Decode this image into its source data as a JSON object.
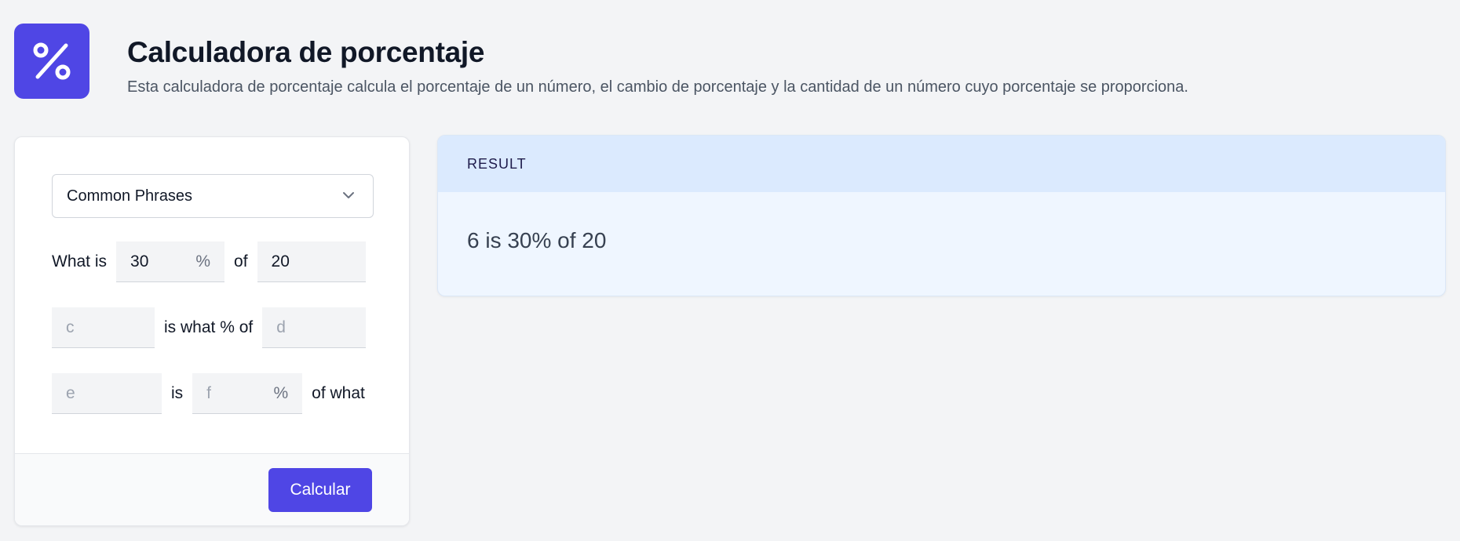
{
  "header": {
    "logo_icon": "percent-icon",
    "title": "Calculadora de porcentaje",
    "subtitle": "Esta calculadora de porcentaje calcula el porcentaje de un número, el cambio de porcentaje y la cantidad de un número cuyo porcentaje se proporciona."
  },
  "form": {
    "select_value": "Common Phrases",
    "row1": {
      "label_a": "What is",
      "input_a_value": "30",
      "pct": "%",
      "label_b": "of",
      "input_b_value": "20"
    },
    "row2": {
      "input_c_placeholder": "c",
      "label": "is what % of",
      "input_d_placeholder": "d"
    },
    "row3": {
      "input_e_placeholder": "e",
      "label_is": "is",
      "input_f_placeholder": "f",
      "pct": "%",
      "label_end": "of what"
    },
    "submit_label": "Calcular"
  },
  "result": {
    "heading": "RESULT",
    "text": "6 is 30% of 20"
  },
  "colors": {
    "accent": "#4f46e5",
    "result_header_bg": "#dbeafe",
    "result_body_bg": "#eff6ff"
  }
}
